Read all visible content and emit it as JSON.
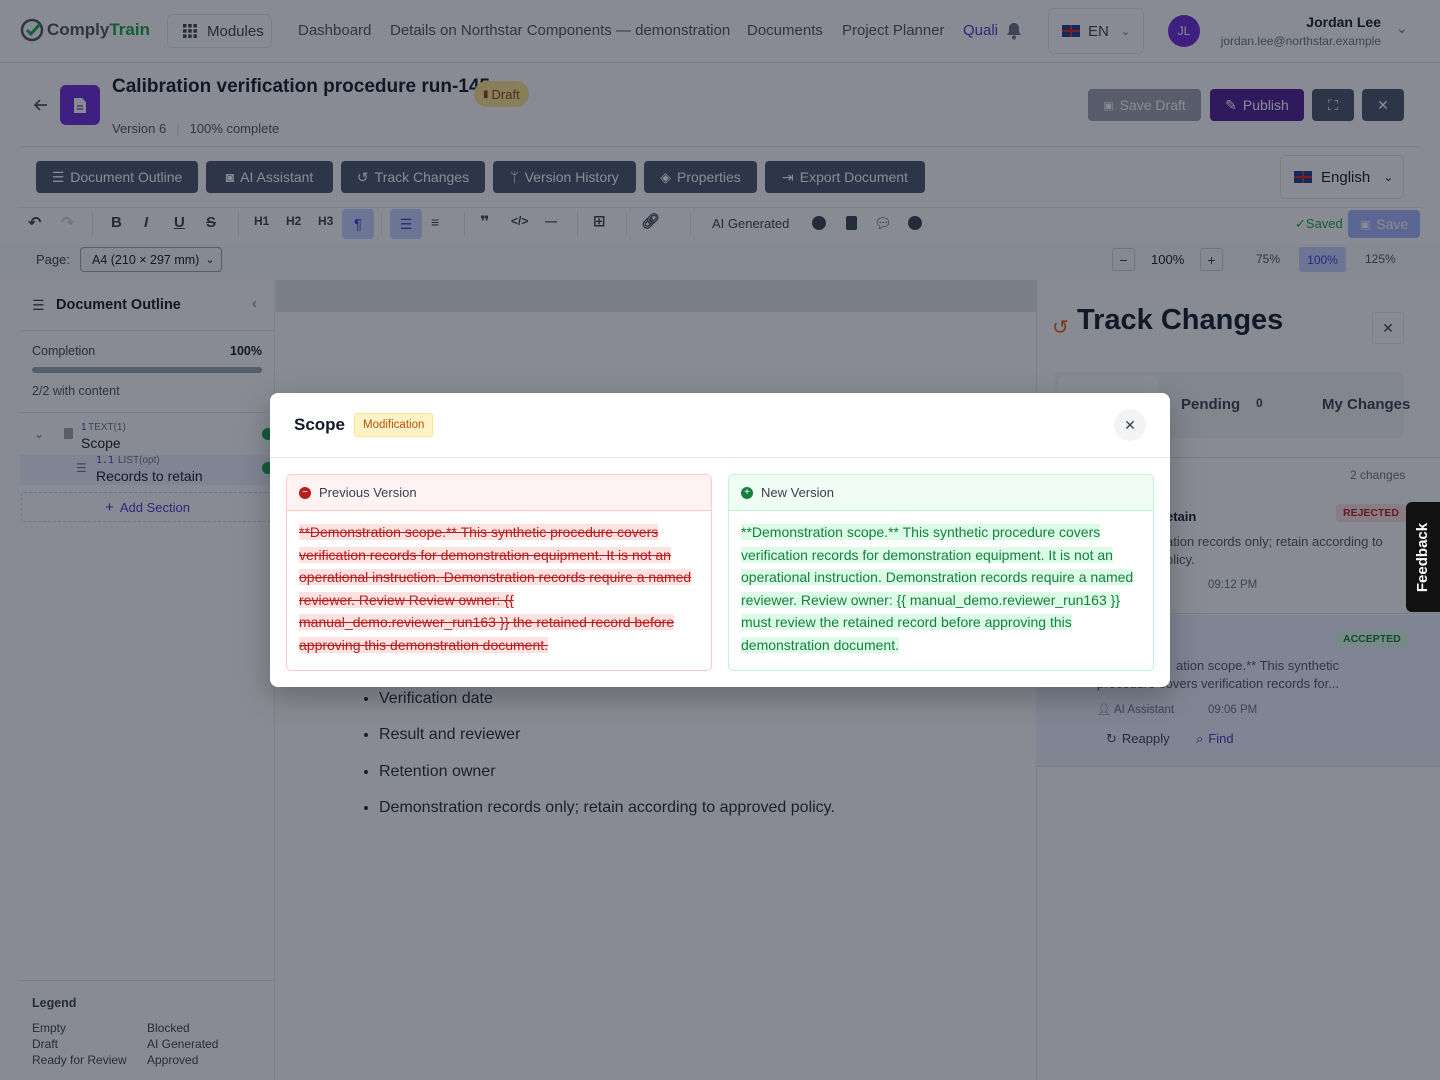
{
  "brand": {
    "prefix": "Comply",
    "suffix": "Train"
  },
  "nav": {
    "modules_label": "Modules",
    "links": [
      "Dashboard",
      "Details on Northstar Components — demonstration",
      "Documents",
      "Project Planner"
    ],
    "active_link": "Quali",
    "lang": "EN"
  },
  "user": {
    "initials": "JL",
    "name": "Jordan Lee",
    "email": "jordan.lee@northstar.example"
  },
  "doc": {
    "title": "Calibration verification procedure run-145",
    "status": "Draft",
    "version": "Version 6",
    "completion": "100% complete"
  },
  "actions": {
    "save_draft": "Save Draft",
    "publish": "Publish"
  },
  "tabs": [
    "Document Outline",
    "AI Assistant",
    "Track Changes",
    "Version History",
    "Properties",
    "Export Document"
  ],
  "language": "English",
  "toolbar": {
    "headings": [
      "H1",
      "H2",
      "H3"
    ],
    "ai_generated": "AI Generated",
    "saved": "✓Saved",
    "save": "Save"
  },
  "page": {
    "label": "Page:",
    "size": "A4 (210 × 297 mm)",
    "zoom": "100%",
    "zoom_presets": [
      "75%",
      "100%",
      "125%"
    ]
  },
  "outline": {
    "title": "Document Outline",
    "completion_label": "Completion",
    "completion_value": "100%",
    "completion_fraction": 1.0,
    "content_count": "2/2 with content",
    "items": [
      {
        "num": "1",
        "type": "TEXT(1)",
        "name": "Scope"
      },
      {
        "num": "1.1",
        "type": "LIST(opt)",
        "name": "Records to retain"
      }
    ],
    "add_section": "Add Section"
  },
  "legend": {
    "title": "Legend",
    "items": [
      "Empty",
      "Blocked",
      "Draft",
      "AI Generated",
      "Ready for Review",
      "Approved"
    ]
  },
  "editor": {
    "bullets": [
      "Verification date",
      "Result and reviewer",
      "Retention owner",
      "Demonstration records only; retain according to approved policy."
    ]
  },
  "track": {
    "title": "Track Changes",
    "tab_pending": "Pending",
    "pending_count": "0",
    "tab_mine": "My Changes",
    "count": "2 changes",
    "card1": {
      "name": "etain",
      "status": "REJECTED",
      "text_l1": "ation records only; retain according to",
      "text_l2": "olicy.",
      "time": "09:12 PM"
    },
    "card2": {
      "status": "ACCEPTED",
      "text_l1": "ation scope.** This synthetic",
      "text_l2": "procedure covers verification records for...",
      "author": "AI Assistant",
      "time": "09:06 PM",
      "reapply": "Reapply",
      "find": "Find"
    }
  },
  "feedback": "Feedback",
  "modal": {
    "title": "Scope",
    "badge": "Modification",
    "old_label": "Previous Version",
    "old_text": "**Demonstration scope.** This synthetic procedure covers verification records for demonstration equipment. It is not an operational instruction. Demonstration records require a named reviewer. Review Review owner: {{ manual_demo.reviewer_run163 }} the retained record before approving this demonstration document.",
    "new_label": "New Version",
    "new_text": "**Demonstration scope.** This synthetic procedure covers verification records for demonstration equipment. It is not an operational instruction. Demonstration records require a named reviewer. Review owner: {{ manual_demo.reviewer_run163 }} must review the retained record before approving this demonstration document."
  },
  "colors": {
    "brand_purple": "#4c1d95",
    "accent_green": "#16a34a",
    "slate": "#475569",
    "rejected": "#dc2626",
    "accepted": "#16a34a"
  }
}
